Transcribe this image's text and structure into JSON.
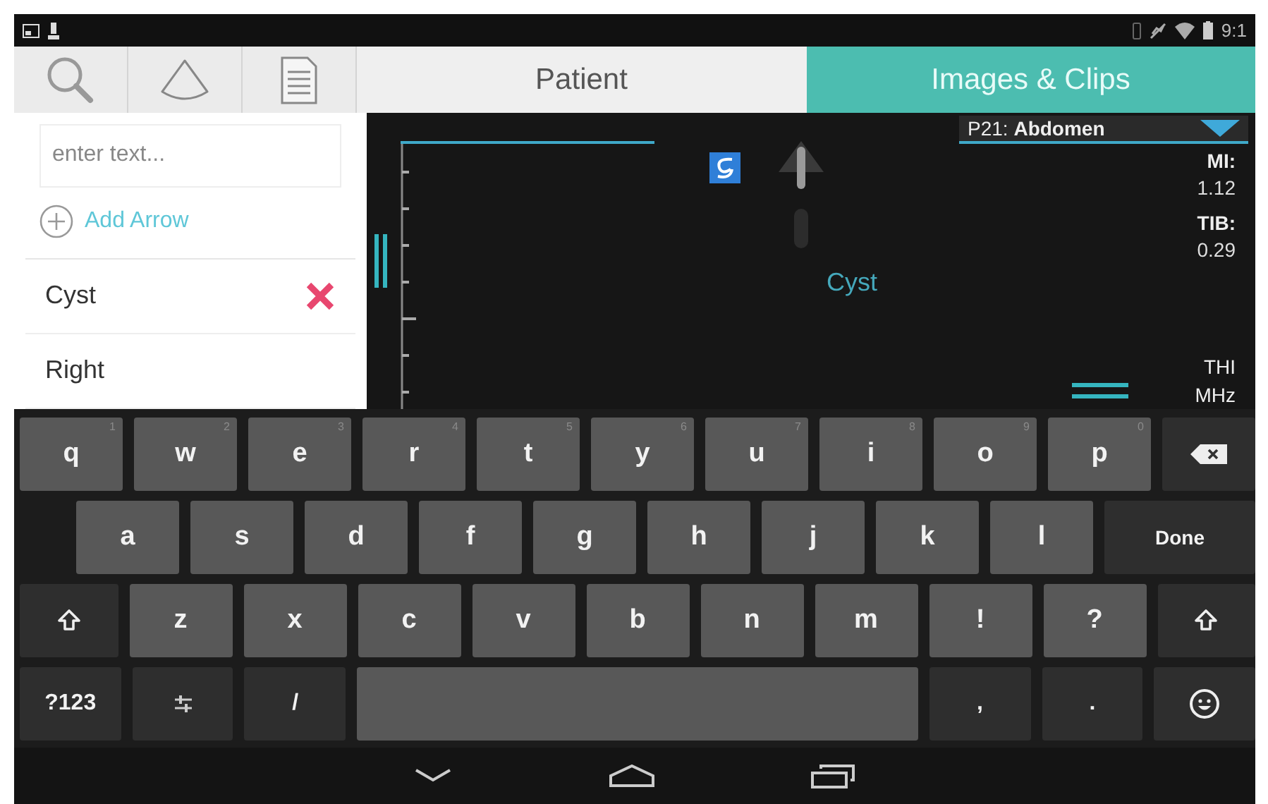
{
  "status_bar": {
    "time": "9:1"
  },
  "header": {
    "tool_tabs": [
      {
        "kind": "search",
        "selected": false
      },
      {
        "kind": "sector",
        "selected": false
      },
      {
        "kind": "report",
        "selected": false
      }
    ],
    "tabs": [
      {
        "label": "Patient",
        "selected": false
      },
      {
        "label": "Images & Clips",
        "selected": true
      }
    ]
  },
  "annotation_panel": {
    "text_field": {
      "placeholder": "enter text..."
    },
    "add_arrow": "Add Arrow",
    "labels": [
      {
        "text": "Cyst",
        "deletable": true
      },
      {
        "text": "Right",
        "deletable": false
      }
    ]
  },
  "image_view": {
    "preset": "P21: **Abdomen**",
    "annotation": "Cyst",
    "readouts": [
      {
        "label": "MI:",
        "value": "1.12"
      },
      {
        "label": "TIB:",
        "value": "0.29"
      }
    ],
    "mode": {
      "label": "THI",
      "value": "MHz"
    }
  },
  "keyboard": {
    "rows": [
      {
        "keys": [
          {
            "kind": "letter",
            "label": "q",
            "hint": "1"
          },
          {
            "kind": "letter",
            "label": "w",
            "hint": "2"
          },
          {
            "kind": "letter",
            "label": "e",
            "hint": "3"
          },
          {
            "kind": "letter",
            "label": "r",
            "hint": "4"
          },
          {
            "kind": "letter",
            "label": "t",
            "hint": "5"
          },
          {
            "kind": "letter",
            "label": "y",
            "hint": "6"
          },
          {
            "kind": "letter",
            "label": "u",
            "hint": "7"
          },
          {
            "kind": "letter",
            "label": "i",
            "hint": "8"
          },
          {
            "kind": "letter",
            "label": "o",
            "hint": "9"
          },
          {
            "kind": "letter",
            "label": "p",
            "hint": "0"
          },
          {
            "kind": "backspace"
          }
        ]
      },
      {
        "keys": [
          {
            "kind": "letter",
            "label": "a"
          },
          {
            "kind": "letter",
            "label": "s"
          },
          {
            "kind": "letter",
            "label": "d"
          },
          {
            "kind": "letter",
            "label": "f"
          },
          {
            "kind": "letter",
            "label": "g"
          },
          {
            "kind": "letter",
            "label": "h"
          },
          {
            "kind": "letter",
            "label": "j"
          },
          {
            "kind": "letter",
            "label": "k"
          },
          {
            "kind": "letter",
            "label": "l"
          },
          {
            "kind": "action",
            "label": "Done"
          }
        ]
      },
      {
        "keys": [
          {
            "kind": "shift"
          },
          {
            "kind": "letter",
            "label": "z"
          },
          {
            "kind": "letter",
            "label": "x"
          },
          {
            "kind": "letter",
            "label": "c"
          },
          {
            "kind": "letter",
            "label": "v"
          },
          {
            "kind": "letter",
            "label": "b"
          },
          {
            "kind": "letter",
            "label": "n"
          },
          {
            "kind": "letter",
            "label": "m"
          },
          {
            "kind": "letter",
            "label": "!"
          },
          {
            "kind": "letter",
            "label": "?"
          },
          {
            "kind": "shift"
          }
        ]
      },
      {
        "keys": [
          {
            "kind": "function",
            "label": "?123"
          },
          {
            "kind": "settings"
          },
          {
            "kind": "function",
            "label": "/"
          },
          {
            "kind": "space"
          },
          {
            "kind": "function",
            "label": ","
          },
          {
            "kind": "function",
            "label": "."
          },
          {
            "kind": "emoji"
          }
        ]
      }
    ]
  }
}
